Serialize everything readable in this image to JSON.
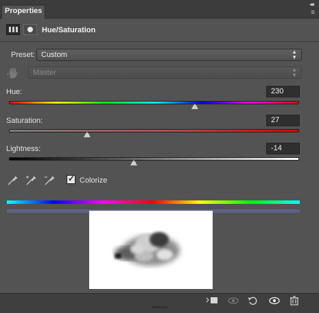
{
  "panel": {
    "tab_label": "Properties",
    "title": "Hue/Saturation",
    "collapse_icon": "double-chevron-right-icon",
    "menu_icon": "panel-menu-icon"
  },
  "preset": {
    "label": "Preset:",
    "value": "Custom"
  },
  "channel": {
    "value": "Master",
    "disabled": true
  },
  "hue": {
    "label": "Hue:",
    "value": "230",
    "fraction": 0.64
  },
  "saturation": {
    "label": "Saturation:",
    "value": "27",
    "fraction": 0.27
  },
  "lightness": {
    "label": "Lightness:",
    "value": "-14",
    "fraction": 0.43
  },
  "colorize": {
    "label": "Colorize",
    "checked": true
  },
  "colors": {
    "panel_bg": "#535353",
    "field_bg": "#2f2f2f",
    "colorize_bar": "#5a6287"
  }
}
